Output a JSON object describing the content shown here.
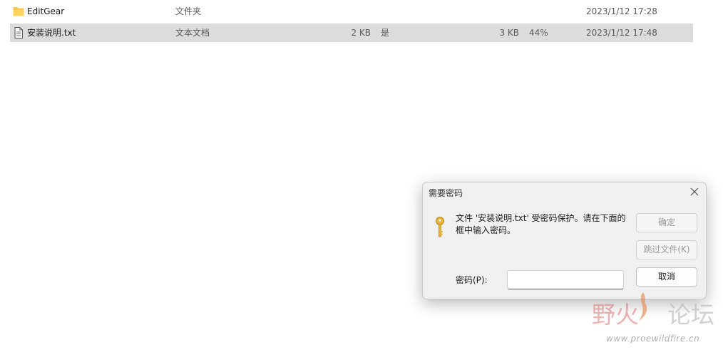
{
  "files": [
    {
      "name": "EditGear",
      "type": "文件夹",
      "size": "",
      "encrypted": "",
      "compressed": "",
      "ratio": "",
      "date": "2023/1/12 17:28"
    },
    {
      "name": "安装说明.txt",
      "type": "文本文档",
      "size": "2 KB",
      "encrypted": "是",
      "compressed": "3 KB",
      "ratio": "44%",
      "date": "2023/1/12 17:48"
    }
  ],
  "dialog": {
    "title": "需要密码",
    "message": "文件 '安装说明.txt' 受密码保护。请在下面的框中输入密码。",
    "ok_label": "确定",
    "skip_label": "跳过文件(K)",
    "cancel_label": "取消",
    "password_label": "密码(P):",
    "password_value": ""
  },
  "watermark": {
    "title_part1": "野火",
    "title_part2": "论坛",
    "url": "www.proewildfire.cn"
  },
  "colors": {
    "folder": "#f6c343",
    "key": "#e8b53a",
    "selection": "#dcdcdc",
    "watermark_red": "#d65656"
  }
}
